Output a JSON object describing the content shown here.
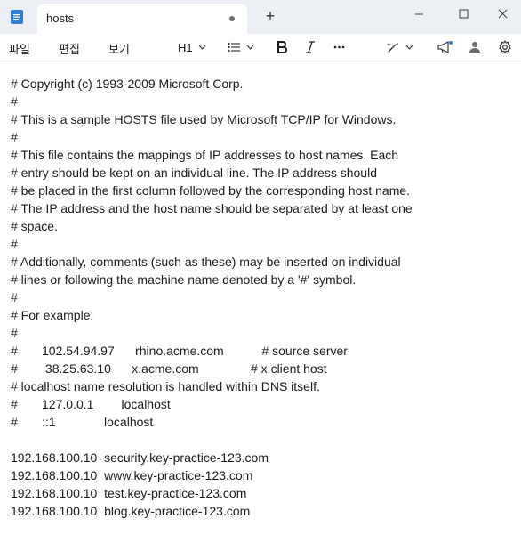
{
  "window": {
    "tab_title": "hosts"
  },
  "menu": {
    "file": "파일",
    "edit": "편집",
    "view": "보기"
  },
  "toolbar": {
    "heading": "H1"
  },
  "document": {
    "lines": [
      "# Copyright (c) 1993-2009 Microsoft Corp.",
      "#",
      "# This is a sample HOSTS file used by Microsoft TCP/IP for Windows.",
      "#",
      "# This file contains the mappings of IP addresses to host names. Each",
      "# entry should be kept on an individual line. The IP address should",
      "# be placed in the first column followed by the corresponding host name.",
      "# The IP address and the host name should be separated by at least one",
      "# space.",
      "#",
      "# Additionally, comments (such as these) may be inserted on individual",
      "# lines or following the machine name denoted by a '#' symbol.",
      "#",
      "# For example:",
      "#",
      "#       102.54.94.97      rhino.acme.com           # source server",
      "#        38.25.63.10      x.acme.com               # x client host",
      "# localhost name resolution is handled within DNS itself.",
      "#       127.0.0.1        localhost",
      "#       ::1              localhost",
      "",
      "192.168.100.10  security.key-practice-123.com",
      "192.168.100.10  www.key-practice-123.com",
      "192.168.100.10  test.key-practice-123.com",
      "192.168.100.10  blog.key-practice-123.com"
    ]
  }
}
